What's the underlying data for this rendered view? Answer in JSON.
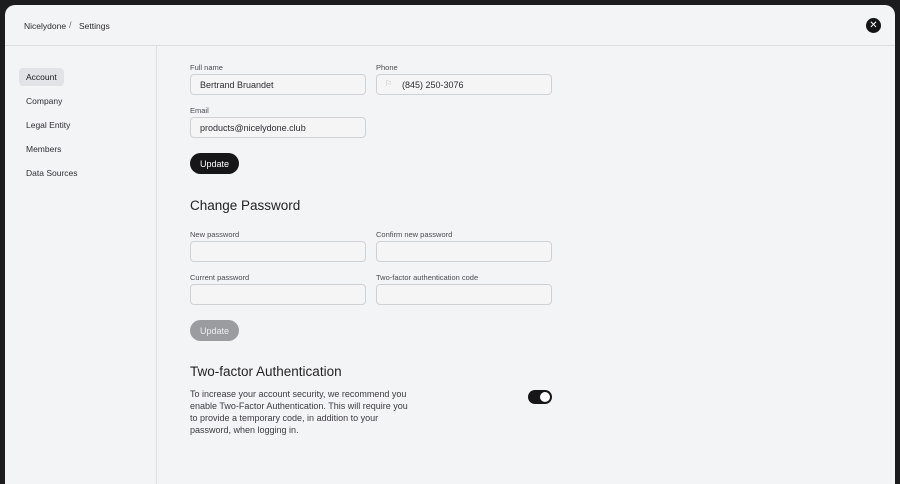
{
  "breadcrumb": {
    "root": "Nicelydone",
    "separator": "/",
    "current": "Settings"
  },
  "sidebar": {
    "items": [
      {
        "label": "Account",
        "active": true
      },
      {
        "label": "Company",
        "active": false
      },
      {
        "label": "Legal Entity",
        "active": false
      },
      {
        "label": "Members",
        "active": false
      },
      {
        "label": "Data Sources",
        "active": false
      }
    ]
  },
  "profile": {
    "full_name_label": "Full name",
    "full_name_value": "Bertrand Bruandet",
    "phone_label": "Phone",
    "phone_value": "(845) 250-3076",
    "email_label": "Email",
    "email_value": "products@nicelydone.club",
    "update_label": "Update"
  },
  "password": {
    "title": "Change Password",
    "new_label": "New password",
    "confirm_label": "Confirm new password",
    "current_label": "Current password",
    "twofa_code_label": "Two-factor authentication code",
    "update_label": "Update"
  },
  "twofa": {
    "title": "Two-factor Authentication",
    "description": "To increase your account security, we recommend you enable Two-Factor Authentication. This will require you to provide a temporary code, in addition to your password, when logging in.",
    "enabled": true
  },
  "icons": {
    "close": "close-icon",
    "flag": "flag-icon"
  },
  "colors": {
    "accent": "#161618",
    "disabled": "#9b9ca0",
    "background": "#f3f4f6"
  }
}
